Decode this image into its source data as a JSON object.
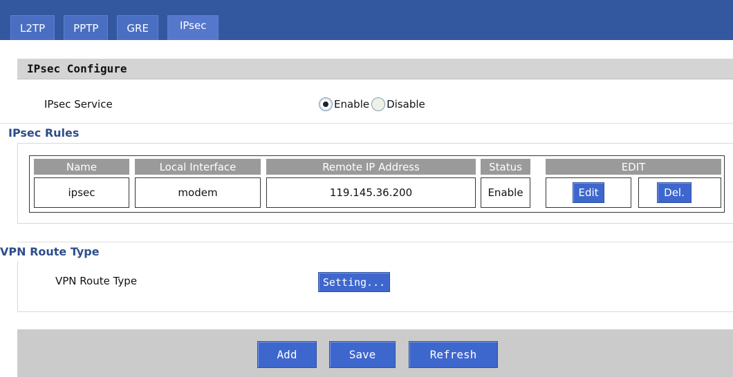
{
  "tabs": [
    {
      "label": "L2TP"
    },
    {
      "label": "PPTP"
    },
    {
      "label": "GRE"
    },
    {
      "label": "IPsec"
    }
  ],
  "configure": {
    "title": "IPsec Configure",
    "service_label": "IPsec Service",
    "enable_label": "Enable",
    "disable_label": "Disable",
    "selected": "Enable"
  },
  "rules": {
    "title": "IPsec Rules",
    "columns": [
      "Name",
      "Local Interface",
      "Remote IP Address",
      "Status",
      "EDIT"
    ],
    "rows": [
      {
        "name": "ipsec",
        "local_interface": "modem",
        "remote_ip": "119.145.36.200",
        "status": "Enable",
        "edit_label": "Edit",
        "delete_label": "Del."
      }
    ]
  },
  "route": {
    "title": "VPN Route Type",
    "label": "VPN Route Type",
    "setting_label": "Setting..."
  },
  "actions": {
    "add_label": "Add",
    "save_label": "Save",
    "refresh_label": "Refresh"
  },
  "colors": {
    "topbar": "#34589f",
    "button": "#3e67cd",
    "section_title": "#2d4d8a",
    "table_header": "#9a9a9a"
  }
}
